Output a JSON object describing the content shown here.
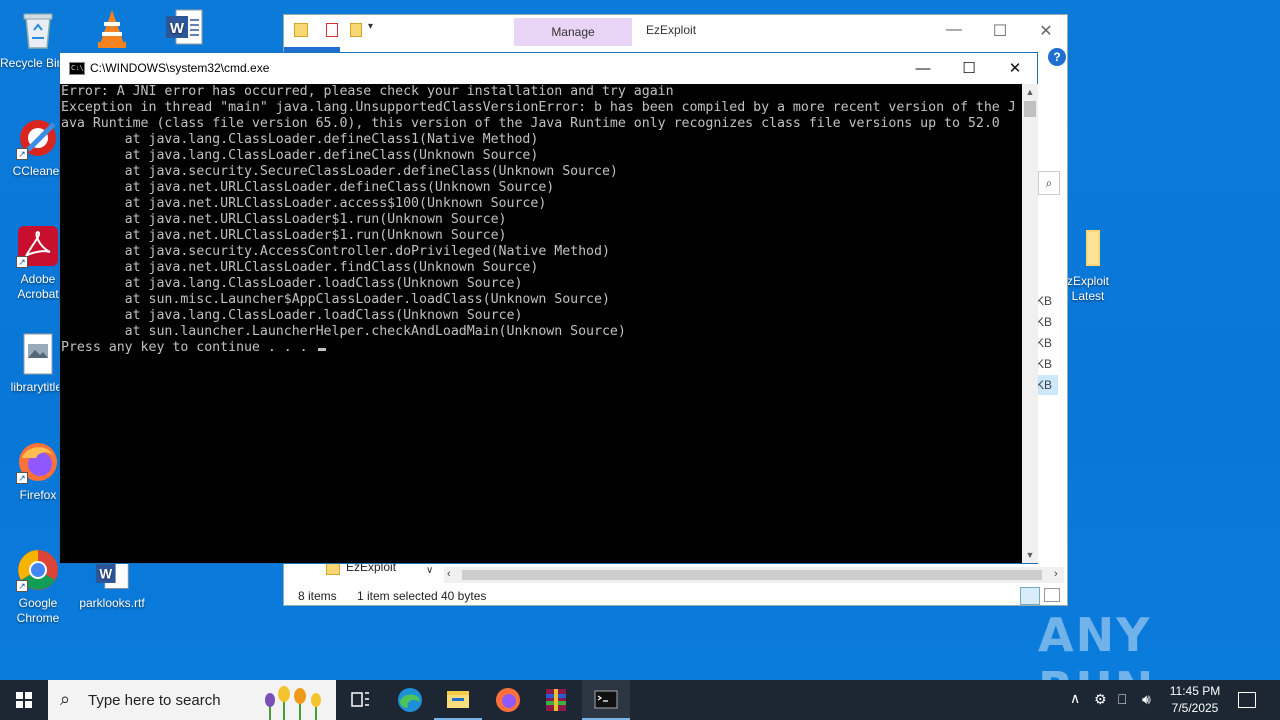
{
  "desktop": {
    "icons": [
      {
        "name": "recycle-bin",
        "label": "Recycle Bin"
      },
      {
        "name": "vlc",
        "label": ""
      },
      {
        "name": "word-doc-top",
        "label": ""
      },
      {
        "name": "ccleaner",
        "label": "CCleaner"
      },
      {
        "name": "adobe-acrobat",
        "label": "Adobe\nAcrobat"
      },
      {
        "name": "librarytitle",
        "label": "librarytitle."
      },
      {
        "name": "firefox",
        "label": "Firefox"
      },
      {
        "name": "google-chrome",
        "label": "Google\nChrome"
      },
      {
        "name": "parklooks",
        "label": "parklooks.rtf"
      },
      {
        "name": "ezexploit-latest",
        "label": "zExploit\nLatest"
      }
    ]
  },
  "explorer": {
    "manage_tab": "Manage",
    "title": "EzExploit",
    "help": "?",
    "sizes": [
      "KB",
      "KB",
      "KB",
      "KB",
      "KB"
    ],
    "nav_item": "EzExploit",
    "status": {
      "items": "8 items",
      "selected": "1 item selected",
      "size": "40 bytes"
    }
  },
  "cmd": {
    "title": "C:\\WINDOWS\\system32\\cmd.exe",
    "lines": [
      "Error: A JNI error has occurred, please check your installation and try again",
      "Exception in thread \"main\" java.lang.UnsupportedClassVersionError: b has been compiled by a more recent version of the J",
      "ava Runtime (class file version 65.0), this version of the Java Runtime only recognizes class file versions up to 52.0",
      "        at java.lang.ClassLoader.defineClass1(Native Method)",
      "        at java.lang.ClassLoader.defineClass(Unknown Source)",
      "        at java.security.SecureClassLoader.defineClass(Unknown Source)",
      "        at java.net.URLClassLoader.defineClass(Unknown Source)",
      "        at java.net.URLClassLoader.access$100(Unknown Source)",
      "        at java.net.URLClassLoader$1.run(Unknown Source)",
      "        at java.net.URLClassLoader$1.run(Unknown Source)",
      "        at java.security.AccessController.doPrivileged(Native Method)",
      "        at java.net.URLClassLoader.findClass(Unknown Source)",
      "        at java.lang.ClassLoader.loadClass(Unknown Source)",
      "        at sun.misc.Launcher$AppClassLoader.loadClass(Unknown Source)",
      "        at java.lang.ClassLoader.loadClass(Unknown Source)",
      "        at sun.launcher.LauncherHelper.checkAndLoadMain(Unknown Source)",
      "Press any key to continue . . . "
    ]
  },
  "watermark": "ANY RUN",
  "taskbar": {
    "search_placeholder": "Type here to search",
    "time": "11:45 PM",
    "date": "7/5/2025"
  },
  "colors": {
    "desktop": "#0a78d7",
    "taskbar": "#1c2733",
    "console_text": "#c0c0c0",
    "manage_tab": "#e8d4f4"
  }
}
